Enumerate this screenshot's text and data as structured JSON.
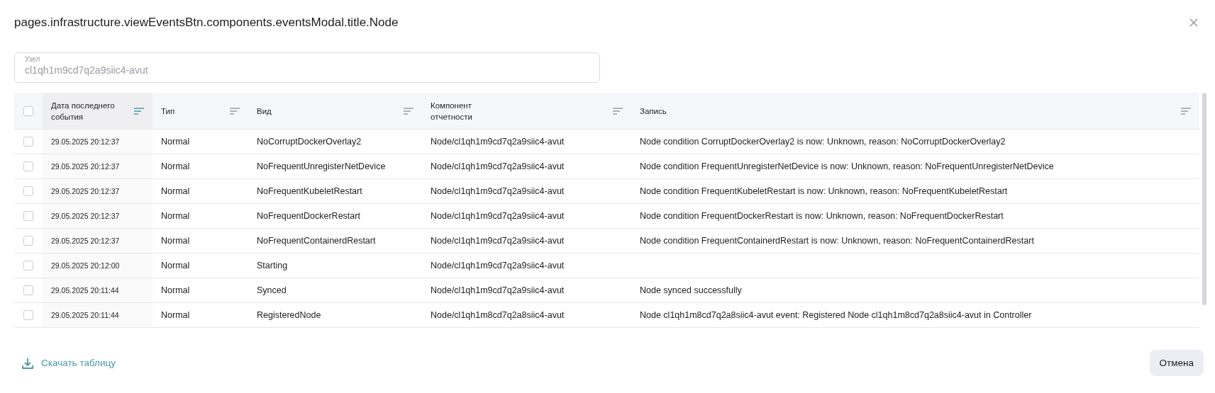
{
  "dialog": {
    "title": "pages.infrastructure.viewEventsBtn.components.eventsModal.title.Node"
  },
  "node_field": {
    "label": "Узел",
    "value": "cl1qh1m9cd7q2a9siic4-avut",
    "disabled": true
  },
  "table": {
    "all_selected": false,
    "columns": [
      {
        "label": "Дата последнего события",
        "sorted": true
      },
      {
        "label": "Тип",
        "sorted": false
      },
      {
        "label": "Вид",
        "sorted": false
      },
      {
        "label": "Компонент отчетности",
        "sorted": false
      },
      {
        "label": "Запись",
        "sorted": false
      }
    ],
    "rows": [
      {
        "selected": false,
        "cells": [
          "29.05.2025 20:12:37",
          "Normal",
          "NoCorruptDockerOverlay2",
          "Node/cl1qh1m9cd7q2a9siic4-avut",
          "Node condition CorruptDockerOverlay2 is now: Unknown, reason: NoCorruptDockerOverlay2"
        ]
      },
      {
        "selected": false,
        "cells": [
          "29.05.2025 20:12:37",
          "Normal",
          "NoFrequentUnregisterNetDevice",
          "Node/cl1qh1m9cd7q2a9siic4-avut",
          "Node condition FrequentUnregisterNetDevice is now: Unknown, reason: NoFrequentUnregisterNetDevice"
        ]
      },
      {
        "selected": false,
        "cells": [
          "29.05.2025 20:12:37",
          "Normal",
          "NoFrequentKubeletRestart",
          "Node/cl1qh1m9cd7q2a9siic4-avut",
          "Node condition FrequentKubeletRestart is now: Unknown, reason: NoFrequentKubeletRestart"
        ]
      },
      {
        "selected": false,
        "cells": [
          "29.05.2025 20:12:37",
          "Normal",
          "NoFrequentDockerRestart",
          "Node/cl1qh1m9cd7q2a9siic4-avut",
          "Node condition FrequentDockerRestart is now: Unknown, reason: NoFrequentDockerRestart"
        ]
      },
      {
        "selected": false,
        "cells": [
          "29.05.2025 20:12:37",
          "Normal",
          "NoFrequentContainerdRestart",
          "Node/cl1qh1m9cd7q2a9siic4-avut",
          "Node condition FrequentContainerdRestart is now: Unknown, reason: NoFrequentContainerdRestart"
        ]
      },
      {
        "selected": false,
        "cells": [
          "29.05.2025 20:12:00",
          "Normal",
          "Starting",
          "Node/cl1qh1m9cd7q2a9siic4-avut"
        ]
      },
      {
        "selected": false,
        "cells": [
          "29.05.2025 20:11:44",
          "Normal",
          "Synced",
          "Node/cl1qh1m9cd7q2a9siic4-avut",
          "Node synced successfully"
        ]
      },
      {
        "selected": false,
        "cells": [
          "29.05.2025 20:11:44",
          "Normal",
          "RegisteredNode",
          "Node/cl1qh1m8cd7q2a8siic4-avut",
          "Node cl1qh1m8cd7q2a8siic4-avut event: Registered Node cl1qh1m8cd7q2a8siic4-avut in Controller"
        ]
      }
    ]
  },
  "footer": {
    "download": "Скачать таблицу",
    "cancel": "Отмена"
  }
}
